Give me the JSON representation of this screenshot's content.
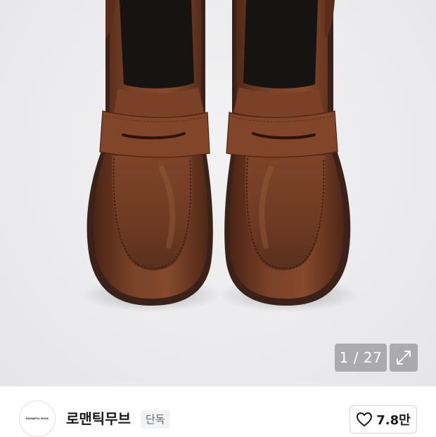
{
  "gallery": {
    "image_alt_icon": "product-photo-brown-penny-loafers",
    "counter_text": "1 / 27",
    "expand_icon": "expand-arrows-icon"
  },
  "store": {
    "logo_text": "ROMANTIC MOVE",
    "name": "로맨틱무브",
    "badge": "단독"
  },
  "like": {
    "icon": "heart-outline-icon",
    "count": "7.8만"
  },
  "colors": {
    "leather": "#6b3620",
    "sole": "#3a2218",
    "background": "#ececee"
  }
}
